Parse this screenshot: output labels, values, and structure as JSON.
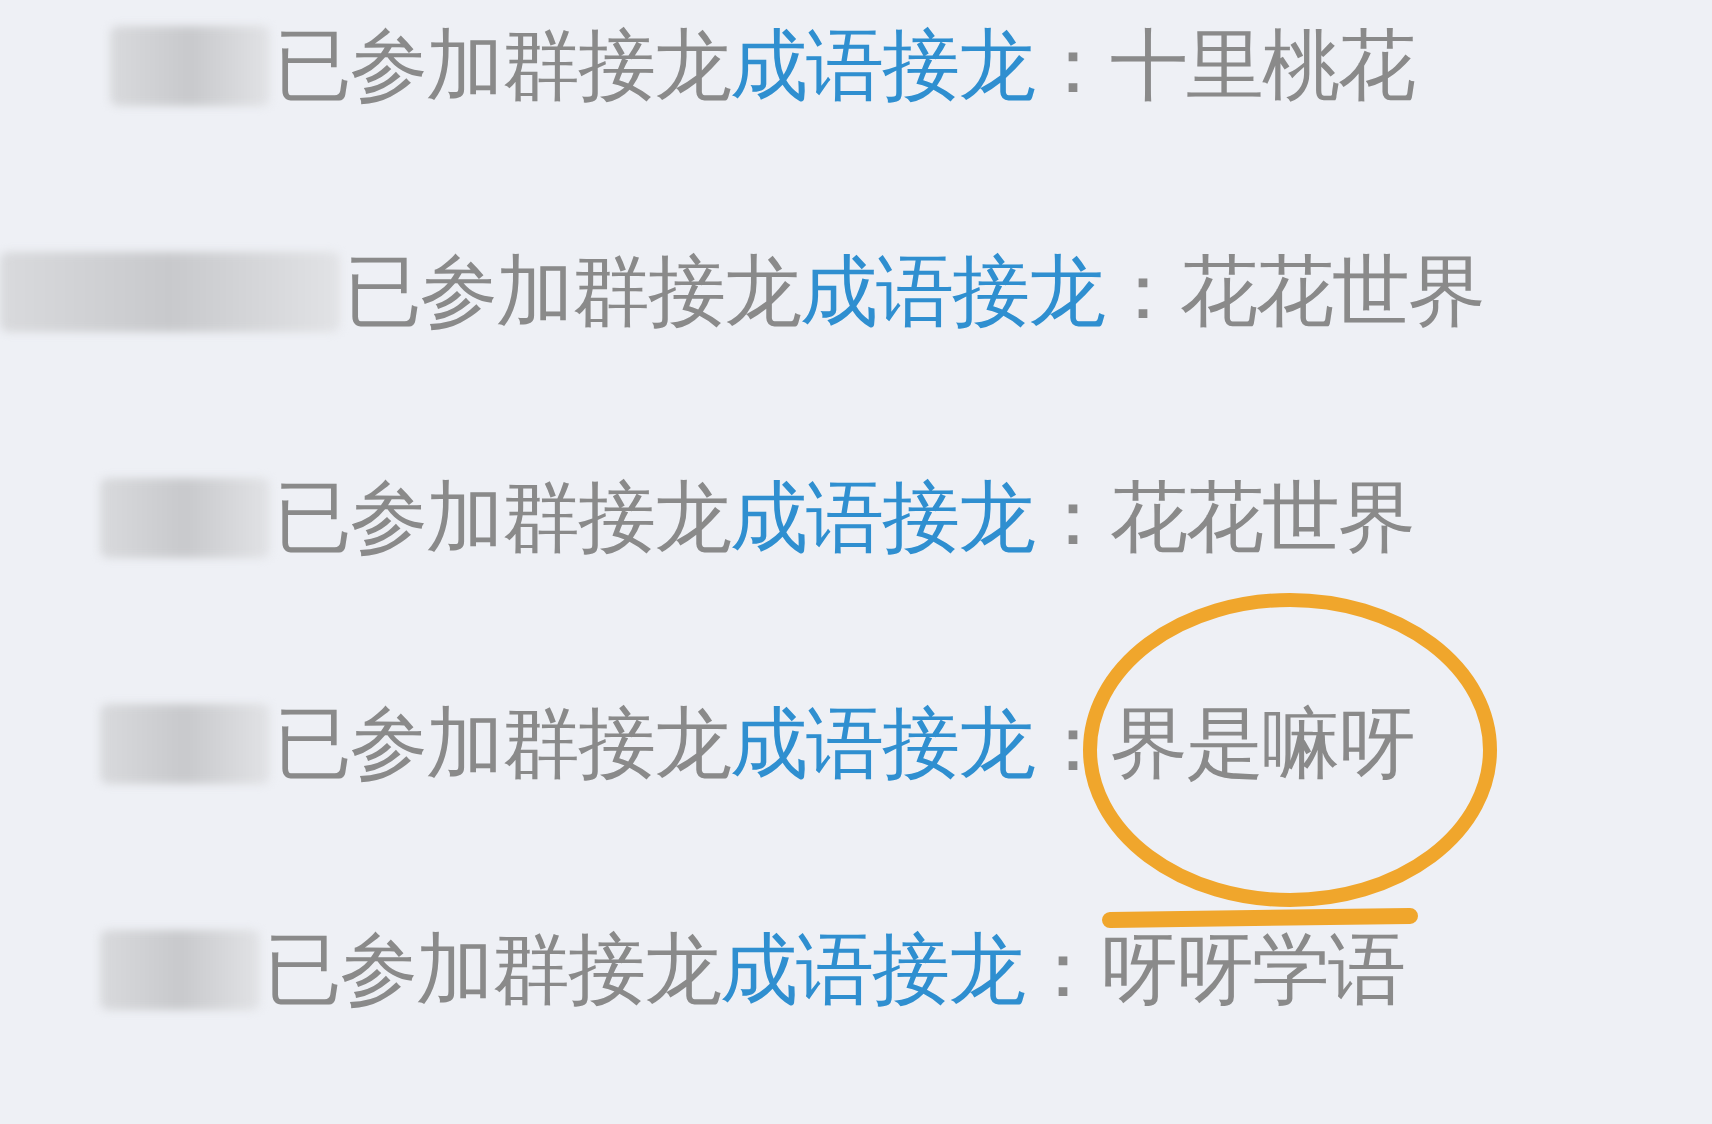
{
  "rows": [
    {
      "joined_text": "已参加群接龙",
      "link": "成语接龙",
      "separator": "：",
      "answer": "十里桃花",
      "circled": false
    },
    {
      "joined_text": "已参加群接龙",
      "link": "成语接龙",
      "separator": "：",
      "answer": "花花世界",
      "circled": false
    },
    {
      "joined_text": "已参加群接龙",
      "link": "成语接龙",
      "separator": "：",
      "answer": "花花世界",
      "circled": false
    },
    {
      "joined_text": "已参加群接龙",
      "link": "成语接龙",
      "separator": "：",
      "answer": "界是嘛呀",
      "circled": true
    },
    {
      "joined_text": "已参加群接龙",
      "link": "成语接龙",
      "separator": "：",
      "answer": "呀呀学语",
      "circled": false
    }
  ]
}
